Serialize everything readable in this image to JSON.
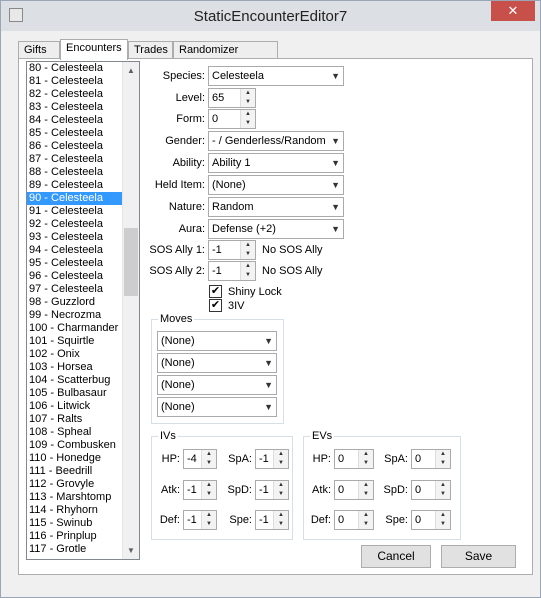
{
  "window": {
    "title": "StaticEncounterEditor7",
    "close": "✕"
  },
  "tabs": [
    "Gifts",
    "Encounters",
    "Trades",
    "Randomizer Options"
  ],
  "encounters": [
    "80 - Celesteela",
    "81 - Celesteela",
    "82 - Celesteela",
    "83 - Celesteela",
    "84 - Celesteela",
    "85 - Celesteela",
    "86 - Celesteela",
    "87 - Celesteela",
    "88 - Celesteela",
    "89 - Celesteela",
    "90 - Celesteela",
    "91 - Celesteela",
    "92 - Celesteela",
    "93 - Celesteela",
    "94 - Celesteela",
    "95 - Celesteela",
    "96 - Celesteela",
    "97 - Celesteela",
    "98 - Guzzlord",
    "99 - Necrozma",
    "100 - Charmander",
    "101 - Squirtle",
    "102 - Onix",
    "103 - Horsea",
    "104 - Scatterbug",
    "105 - Bulbasaur",
    "106 - Litwick",
    "107 - Ralts",
    "108 - Spheal",
    "109 - Combusken",
    "110 - Honedge",
    "111 - Beedrill",
    "112 - Grovyle",
    "113 - Marshtomp",
    "114 - Rhyhorn",
    "115 - Swinub",
    "116 - Prinplup",
    "117 - Grotle"
  ],
  "selected_index": 10,
  "labels": {
    "species": "Species:",
    "level": "Level:",
    "form": "Form:",
    "gender": "Gender:",
    "ability": "Ability:",
    "held_item": "Held Item:",
    "nature": "Nature:",
    "aura": "Aura:",
    "sos1": "SOS Ally 1:",
    "sos2": "SOS Ally 2:"
  },
  "values": {
    "species": "Celesteela",
    "level": "65",
    "form": "0",
    "gender": "- / Genderless/Random",
    "ability": "Ability 1",
    "held_item": "(None)",
    "nature": "Random",
    "aura": "Defense (+2)",
    "sos1": "-1",
    "sos2": "-1",
    "sos1_text": "No SOS Ally",
    "sos2_text": "No SOS Ally"
  },
  "checks": {
    "shiny_lock": "Shiny Lock",
    "iv3": "3IV",
    "check_mark": "✔"
  },
  "moves": {
    "title": "Moves",
    "items": [
      "(None)",
      "(None)",
      "(None)",
      "(None)"
    ]
  },
  "ivs": {
    "title": "IVs",
    "hp_label": "HP:",
    "atk_label": "Atk:",
    "def_label": "Def:",
    "spa_label": "SpA:",
    "spd_label": "SpD:",
    "spe_label": "Spe:",
    "hp": "-4",
    "atk": "-1",
    "def": "-1",
    "spa": "-1",
    "spd": "-1",
    "spe": "-1"
  },
  "evs": {
    "title": "EVs",
    "hp_label": "HP:",
    "atk_label": "Atk:",
    "def_label": "Def:",
    "spa_label": "SpA:",
    "spd_label": "SpD:",
    "spe_label": "Spe:",
    "hp": "0",
    "atk": "0",
    "def": "0",
    "spa": "0",
    "spd": "0",
    "spe": "0"
  },
  "buttons": {
    "cancel": "Cancel",
    "save": "Save"
  },
  "icons": {
    "dropdown": "▼",
    "up": "▲",
    "down": "▼"
  }
}
